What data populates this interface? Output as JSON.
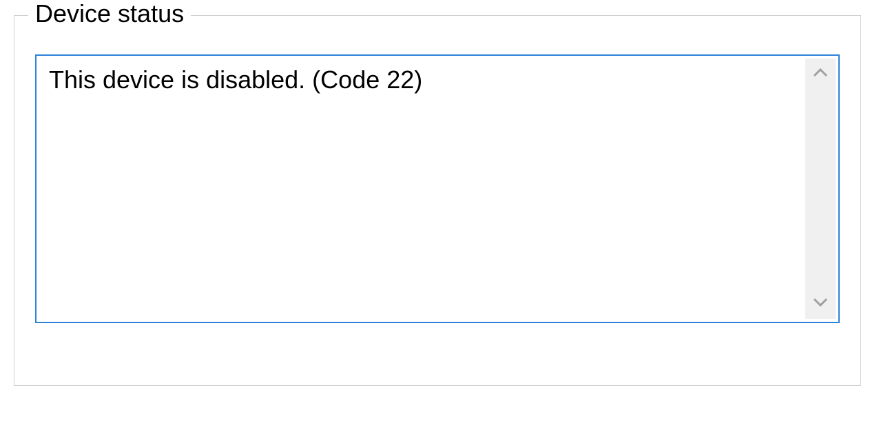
{
  "deviceStatus": {
    "legend": "Device status",
    "message": "This device is disabled. (Code 22)"
  }
}
